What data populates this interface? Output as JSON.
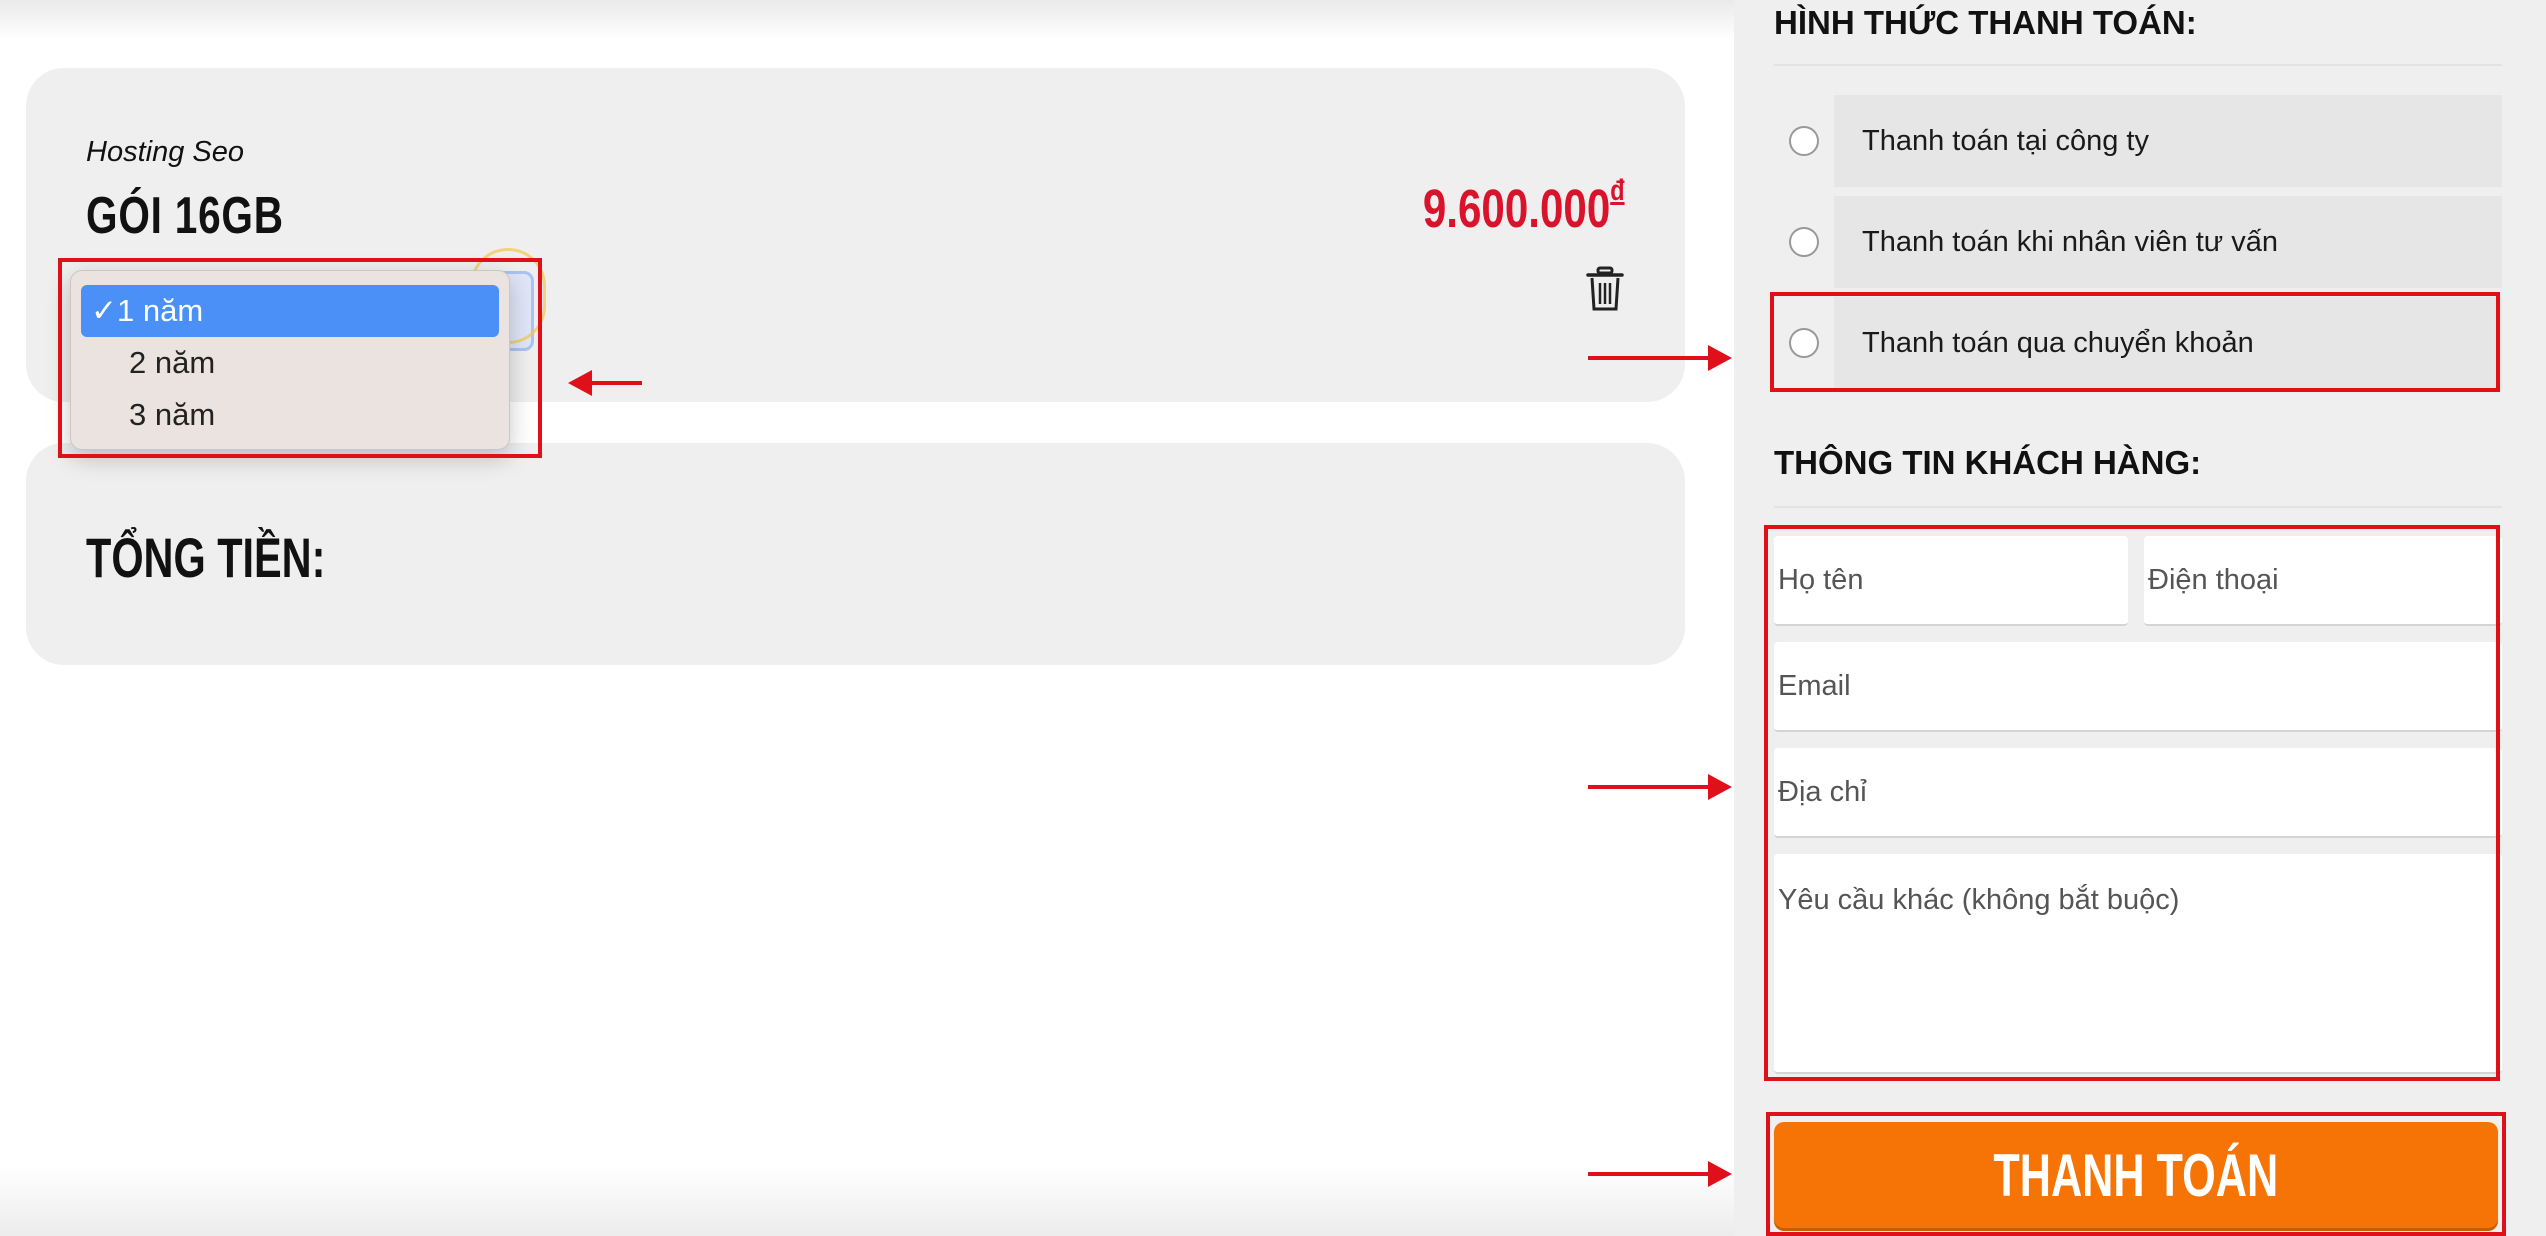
{
  "product": {
    "subtitle": "Hosting Seo",
    "package_name": "GÓI 16GB",
    "price": "9.600.000",
    "currency_symbol": "đ"
  },
  "duration_select": {
    "options": [
      {
        "label": "1 năm",
        "selected": true
      },
      {
        "label": "2 năm",
        "selected": false
      },
      {
        "label": "3 năm",
        "selected": false
      }
    ],
    "check_mark": "✓"
  },
  "total": {
    "label": "TỔNG TIỀN:"
  },
  "payment": {
    "title": "HÌNH THỨC THANH TOÁN:",
    "methods": [
      {
        "label": "Thanh toán tại công ty"
      },
      {
        "label": "Thanh toán khi nhân viên tư vấn"
      },
      {
        "label": "Thanh toán qua chuyển khoản"
      }
    ]
  },
  "customer": {
    "title": "THÔNG TIN KHÁCH HÀNG:",
    "name_placeholder": "Họ tên",
    "phone_placeholder": "Điện thoại",
    "email_placeholder": "Email",
    "address_placeholder": "Địa chỉ",
    "note_placeholder": "Yêu cầu khác (không bắt buộc)"
  },
  "submit_label": "THANH TOÁN",
  "colors": {
    "price": "#d9132b",
    "button": "#f57405",
    "annotation": "#e0101a",
    "selected_option": "#4a90f7"
  }
}
